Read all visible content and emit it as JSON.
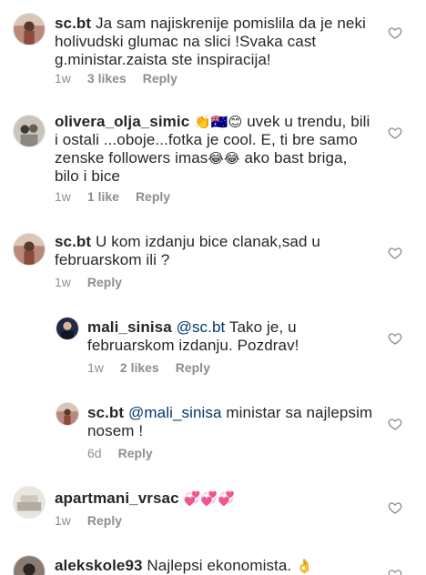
{
  "comments": [
    {
      "username": "sc.bt",
      "text": "Ja sam najiskrenije pomislila da je neki holivudski glumac na slici !Svaka cast g.ministar.zaista ste inspiracija!",
      "time": "1w",
      "likes": "3 likes",
      "reply": "Reply"
    },
    {
      "username": "olivera_olja_simic",
      "emojis_start": "👏🇦🇺😊",
      "text_a": " uvek u trendu, bili i ostali ...oboje...fotka je cool. E, ti bre samo zenske followers imas",
      "emojis_mid": "😂😂",
      "text_b": " ako bast briga, bilo i bice",
      "time": "1w",
      "likes": "1 like",
      "reply": "Reply"
    },
    {
      "username": "sc.bt",
      "text": "U kom izdanju bice clanak,sad u februarskom ili ?",
      "time": "1w",
      "reply": "Reply"
    },
    {
      "username": "mali_sinisa",
      "mention": "@sc.bt",
      "text": " Tako je, u februarskom izdanju. Pozdrav!",
      "time": "1w",
      "likes": "2 likes",
      "reply": "Reply"
    },
    {
      "username": "sc.bt",
      "mention": "@mali_sinisa",
      "text": " ministar sa najlepsim nosem !",
      "time": "6d",
      "reply": "Reply"
    },
    {
      "username": "apartmani_vrsac",
      "emojis": "💞💞💞",
      "time": "1w",
      "reply": "Reply"
    },
    {
      "username": "alekskole93",
      "text": "Najlepsi ekonomista.",
      "emojis": "👌"
    }
  ],
  "icons": {
    "heart": "heart-outline-icon"
  },
  "colors": {
    "text": "#262626",
    "meta": "#8e8e8e",
    "mention": "#00376b"
  }
}
